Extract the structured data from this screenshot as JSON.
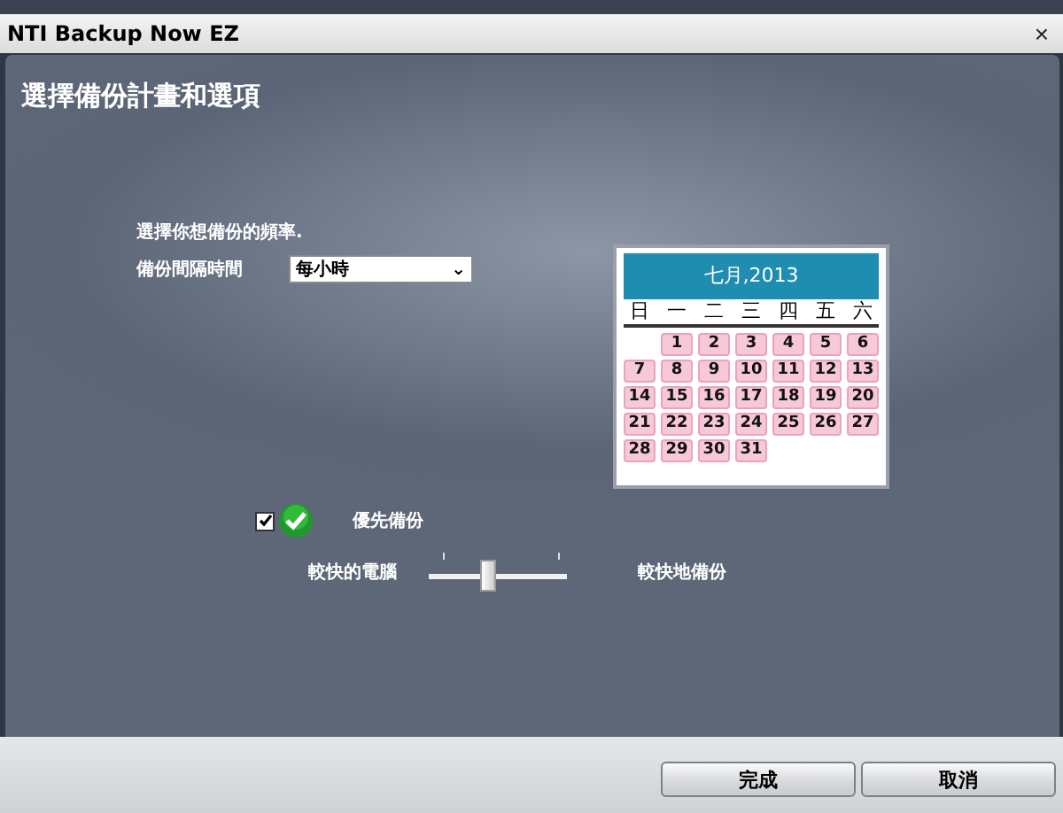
{
  "window": {
    "title": "NTI Backup Now EZ",
    "close": "×"
  },
  "heading": "選擇備份計畫和選項",
  "frequency": {
    "prompt": "選擇你想備份的頻率.",
    "label": "備份間隔時間",
    "value": "每小時",
    "caret": "⌄"
  },
  "calendar": {
    "title": "七月,2013",
    "weekdays": [
      "日",
      "一",
      "二",
      "三",
      "四",
      "五",
      "六"
    ],
    "weeks": [
      [
        "1",
        "2",
        "3",
        "4",
        "5",
        "6"
      ],
      [
        "7",
        "8",
        "9",
        "10",
        "11",
        "12",
        "13"
      ],
      [
        "14",
        "15",
        "16",
        "17",
        "18",
        "19",
        "20"
      ],
      [
        "21",
        "22",
        "23",
        "24",
        "25",
        "26",
        "27"
      ],
      [
        "28",
        "29",
        "30",
        "31"
      ]
    ]
  },
  "priority": {
    "label": "優先備份",
    "checked": true
  },
  "speed": {
    "left_label": "較快的電腦",
    "right_label": "較快地備份",
    "level": 0.42
  },
  "buttons": [
    "完成",
    "取消"
  ]
}
